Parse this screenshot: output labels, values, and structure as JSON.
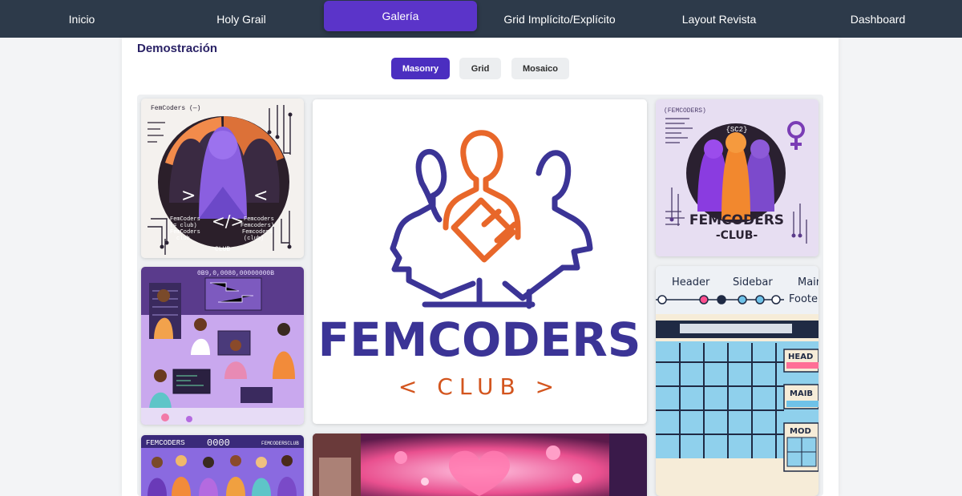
{
  "nav": {
    "items": [
      {
        "label": "Inicio"
      },
      {
        "label": "Holy Grail"
      },
      {
        "label": "Galería"
      },
      {
        "label": "Grid Implícito/Explícito"
      },
      {
        "label": "Layout Revista"
      },
      {
        "label": "Dashboard"
      }
    ],
    "active_index": 2
  },
  "page": {
    "section_title": "Demostración"
  },
  "layout_switch": {
    "options": [
      {
        "label": "Masonry"
      },
      {
        "label": "Grid"
      },
      {
        "label": "Mosaico"
      }
    ],
    "selected": "Masonry"
  },
  "gallery": {
    "logo_text": {
      "brand": "FEMCODERS",
      "sub": "< CLUB >"
    },
    "tile1_text": {
      "top": "FemCoders (—)",
      "mid1": "FemCoders",
      "mid2": "(= club)",
      "mid3": "FemCoders",
      "mid4": "club",
      "right1": "Femcoders",
      "right2": "Femcoders)",
      "right3": "Femcoders",
      "right4": "(club)",
      "bottom": "CLUB"
    },
    "tile3_text": {
      "top": "(FEMCODERS)",
      "badge": "{SC2}",
      "brand": "FEMCODERS",
      "sub": "-CLUB-"
    },
    "tile4_text": {
      "header": "Header",
      "sidebar": "Sidebar",
      "main": "Mair",
      "footer": "Footer",
      "head_box": "HEAD",
      "main_box": "MAIB",
      "mod_box": "MOD"
    },
    "tile5_text": {
      "code": "0B9,0,0080,00000000B"
    },
    "tile6_text": {
      "brand": "FEMCODERS",
      "digits": "0000",
      "club": "FEMCODERSCLUB"
    }
  },
  "colors": {
    "nav_bg": "#2d3a4a",
    "accent": "#5b34c9",
    "logo_purple": "#3b3496",
    "logo_orange": "#e8672a"
  }
}
